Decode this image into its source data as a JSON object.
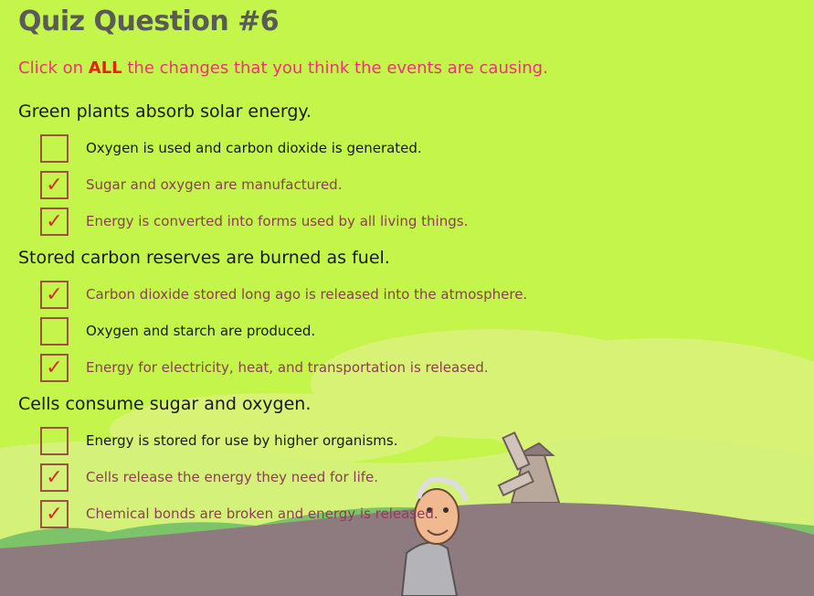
{
  "title": "Quiz Question #6",
  "instruction": {
    "prefix": "Click on ",
    "emphasis": "ALL",
    "suffix": " the changes that you think the events are causing."
  },
  "questions": [
    {
      "text": "Green plants absorb solar energy.",
      "options": [
        {
          "text": "Oxygen is used and carbon dioxide is generated.",
          "checked": false,
          "mark": ""
        },
        {
          "text": "Sugar and oxygen are manufactured.",
          "checked": true,
          "mark": "✓"
        },
        {
          "text": "Energy is converted into forms used by all living things.",
          "checked": true,
          "mark": "✓"
        }
      ]
    },
    {
      "text": "Stored carbon reserves are burned as fuel.",
      "options": [
        {
          "text": "Carbon dioxide stored long ago is released into the atmosphere.",
          "checked": true,
          "mark": "✓"
        },
        {
          "text": "Oxygen and starch are produced.",
          "checked": false,
          "mark": ""
        },
        {
          "text": "Energy for electricity, heat, and transportation is released.",
          "checked": true,
          "mark": "✓"
        }
      ]
    },
    {
      "text": "Cells consume sugar and oxygen.",
      "options": [
        {
          "text": "Energy is stored for use by higher organisms.",
          "checked": false,
          "mark": ""
        },
        {
          "text": "Cells release the energy they need for life.",
          "checked": true,
          "mark": "✓"
        },
        {
          "text": "Chemical bonds are broken and energy is released.",
          "checked": true,
          "mark": "✓"
        }
      ]
    }
  ],
  "colors": {
    "background": "#c3f54a",
    "title": "#5a5a5a",
    "instruction": "#f0317a",
    "emphasis": "#e8220b",
    "checkbox_border": "#9b5340",
    "checkmark": "#d82a2a",
    "checked_text": "#8c3f52",
    "hill": "#8d7b80"
  }
}
